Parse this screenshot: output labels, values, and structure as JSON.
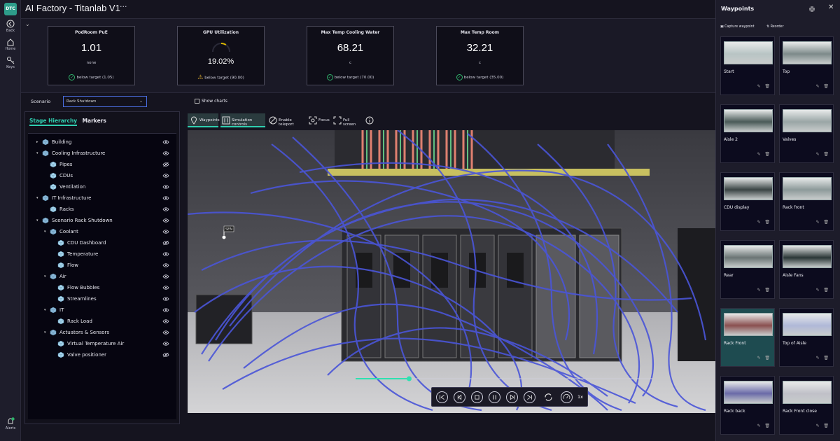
{
  "app": {
    "title": "AI Factory - Titanlab V1",
    "more": "···",
    "logo": "DTC"
  },
  "rail": [
    {
      "icon": "back-icon",
      "label": "Back"
    },
    {
      "icon": "home-icon",
      "label": "Home"
    },
    {
      "icon": "keys-icon",
      "label": "Keys"
    },
    {
      "icon": "alerts-icon",
      "label": "Alerts",
      "badge": "1"
    }
  ],
  "kpis": [
    {
      "title": "PodRoom PuE",
      "value": "1.01",
      "unit": "none",
      "status": "below target (1.05)",
      "status_kind": "ok"
    },
    {
      "title": "GPU Utilization",
      "value": "19.02%",
      "unit": "",
      "status": "below target (90.00)",
      "status_kind": "warn",
      "gauge_fraction": 0.19
    },
    {
      "title": "Max Temp Cooling Water",
      "value": "68.21",
      "unit": "c",
      "status": "below target (70.00)",
      "status_kind": "ok"
    },
    {
      "title": "Max Temp Room",
      "value": "32.21",
      "unit": "c",
      "status": "below target (35.00)",
      "status_kind": "ok"
    }
  ],
  "scenario": {
    "label": "Scenario",
    "selected": "Rack Shutdown",
    "show_charts": "Show charts"
  },
  "stage_tabs": [
    {
      "label": "Stage Hierarchy",
      "active": true
    },
    {
      "label": "Markers",
      "active": false
    }
  ],
  "tree": [
    {
      "label": "Building",
      "level": 0,
      "arrow": "▸",
      "kind": "group",
      "eye": "visible"
    },
    {
      "label": "Cooling Infrastructure",
      "level": 0,
      "arrow": "▾",
      "kind": "group",
      "eye": "visible"
    },
    {
      "label": "Pipes",
      "level": 1,
      "arrow": "",
      "kind": "cube",
      "eye": "hidden"
    },
    {
      "label": "CDUs",
      "level": 1,
      "arrow": "",
      "kind": "cube",
      "eye": "visible"
    },
    {
      "label": "Ventilation",
      "level": 1,
      "arrow": "",
      "kind": "cube",
      "eye": "visible"
    },
    {
      "label": "IT Infrastructure",
      "level": 0,
      "arrow": "▾",
      "kind": "group",
      "eye": "visible"
    },
    {
      "label": "Racks",
      "level": 1,
      "arrow": "",
      "kind": "cube",
      "eye": "visible"
    },
    {
      "label": "Scenario Rack Shutdown",
      "level": 0,
      "arrow": "▾",
      "kind": "group",
      "eye": "visible"
    },
    {
      "label": "Coolant",
      "level": 1,
      "arrow": "▾",
      "kind": "group",
      "eye": "visible"
    },
    {
      "label": "CDU Dashboard",
      "level": 2,
      "arrow": "",
      "kind": "cube",
      "eye": "hidden"
    },
    {
      "label": "Temperature",
      "level": 2,
      "arrow": "",
      "kind": "cube",
      "eye": "visible"
    },
    {
      "label": "Flow",
      "level": 2,
      "arrow": "",
      "kind": "cube",
      "eye": "visible"
    },
    {
      "label": "Air",
      "level": 1,
      "arrow": "▾",
      "kind": "group",
      "eye": "visible"
    },
    {
      "label": "Flow Bubbles",
      "level": 2,
      "arrow": "",
      "kind": "cube",
      "eye": "visible"
    },
    {
      "label": "Streamlines",
      "level": 2,
      "arrow": "",
      "kind": "cube",
      "eye": "visible"
    },
    {
      "label": "IT",
      "level": 1,
      "arrow": "▾",
      "kind": "group",
      "eye": "visible"
    },
    {
      "label": "Rack Load",
      "level": 2,
      "arrow": "",
      "kind": "cube",
      "eye": "visible"
    },
    {
      "label": "Actuators & Sensors",
      "level": 1,
      "arrow": "▾",
      "kind": "group",
      "eye": "visible"
    },
    {
      "label": "Virtual Temperature Air",
      "level": 2,
      "arrow": "",
      "kind": "cube",
      "eye": "visible"
    },
    {
      "label": "Valve positioner",
      "level": 2,
      "arrow": "",
      "kind": "cube",
      "eye": "hidden"
    }
  ],
  "viewer_toolbar": [
    {
      "label": "Waypoints",
      "icon": "pin-icon",
      "active": true
    },
    {
      "label": "Simulation controls",
      "icon": "sliders-icon",
      "active": true
    },
    {
      "label": "Enable teleport",
      "icon": "no-teleport-icon",
      "active": false
    },
    {
      "label": "Focus",
      "icon": "focus-icon",
      "active": false
    },
    {
      "label": "Full screen",
      "icon": "fullscreen-icon",
      "active": false
    },
    {
      "label": "",
      "icon": "info-icon",
      "active": false
    }
  ],
  "viewport": {
    "progress": 0.18,
    "marker_label": "SEN"
  },
  "playback": {
    "speed": "1x",
    "buttons": [
      "skip-start-icon",
      "step-back-icon",
      "stop-icon",
      "pause-icon",
      "play-icon",
      "skip-end-icon",
      "loop-icon",
      "speed-icon"
    ]
  },
  "waypoints": {
    "title": "Waypoints",
    "capture": "Capture waypoint",
    "reorder": "Reorder",
    "items": [
      {
        "name": "Start",
        "active": false
      },
      {
        "name": "Top",
        "active": false
      },
      {
        "name": "Aisle 2",
        "active": false
      },
      {
        "name": "Valves",
        "active": false
      },
      {
        "name": "CDU display",
        "active": false
      },
      {
        "name": "Rack front",
        "active": false
      },
      {
        "name": "Rear",
        "active": false
      },
      {
        "name": "Aisle Fans",
        "active": false
      },
      {
        "name": "Rack Front",
        "active": true
      },
      {
        "name": "Top of Aisle",
        "active": false
      },
      {
        "name": "Rack back",
        "active": false
      },
      {
        "name": "Rack Front close",
        "active": false
      }
    ]
  },
  "colors": {
    "accent": "#2fcfb0",
    "ok": "#2fb26a",
    "warn": "#e0b030",
    "streamline": "#4a55d8"
  }
}
